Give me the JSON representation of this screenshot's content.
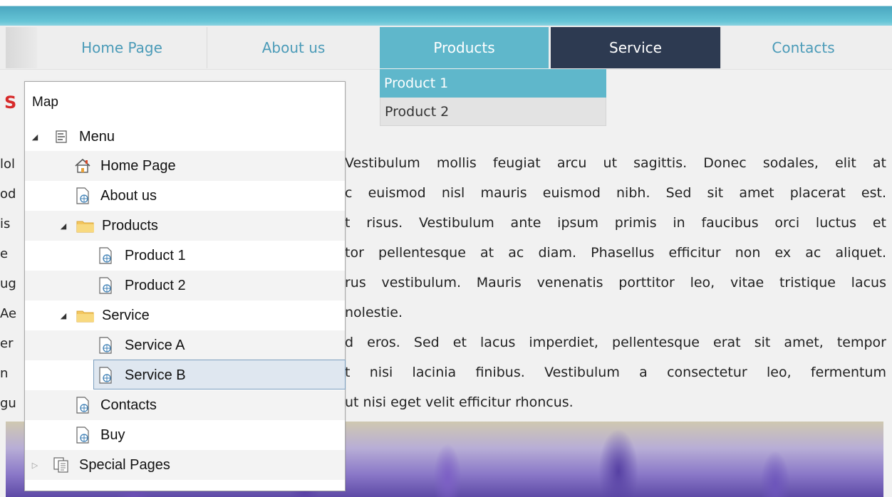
{
  "nav": {
    "items": [
      "Home Page",
      "About us",
      "Products",
      "Service",
      "Contacts"
    ]
  },
  "dropdown": {
    "items": [
      "Product 1",
      "Product 2"
    ]
  },
  "page": {
    "heading_fragment": "S",
    "left_fragments": [
      "lol",
      "od",
      "is",
      "e",
      "ug",
      "Ae",
      "er",
      "n",
      "gu"
    ],
    "paragraph_lines": [
      "Vestibulum mollis feugiat arcu ut sagittis. Donec sodales, elit at",
      "c euismod nisl mauris euismod nibh. Sed sit amet placerat est.",
      "t risus. Vestibulum ante ipsum primis in faucibus orci luctus et",
      "tor pellentesque at ac diam. Phasellus efficitur non ex ac aliquet.",
      "rus vestibulum. Mauris venenatis porttitor leo, vitae tristique lacus",
      "nolestie.",
      "d eros. Sed et lacus imperdiet, pellentesque erat sit amet, tempor",
      "t nisi lacinia finibus. Vestibulum a consectetur leo, fermentum",
      "ut nisi eget velit efficitur rhoncus."
    ]
  },
  "map": {
    "title": "Map",
    "tree": [
      {
        "label": "Menu",
        "icon": "menu-icon",
        "expanded": true
      },
      {
        "label": "Home Page",
        "icon": "home-icon"
      },
      {
        "label": "About us",
        "icon": "web-page-icon"
      },
      {
        "label": "Products",
        "icon": "folder-icon",
        "expanded": true
      },
      {
        "label": "Product 1",
        "icon": "web-page-icon"
      },
      {
        "label": "Product 2",
        "icon": "web-page-icon"
      },
      {
        "label": "Service",
        "icon": "folder-icon",
        "expanded": true
      },
      {
        "label": "Service A",
        "icon": "web-page-icon"
      },
      {
        "label": "Service B",
        "icon": "web-page-icon",
        "selected": true
      },
      {
        "label": "Contacts",
        "icon": "web-page-icon"
      },
      {
        "label": "Buy",
        "icon": "web-page-icon"
      },
      {
        "label": "Special Pages",
        "icon": "pages-icon",
        "expanded": false
      }
    ]
  },
  "colors": {
    "accent": "#5fb7cb",
    "dark_nav": "#2d3a51",
    "link": "#4b9bb8",
    "heading_red": "#d72a2a",
    "selection": "#dfe7f0"
  }
}
